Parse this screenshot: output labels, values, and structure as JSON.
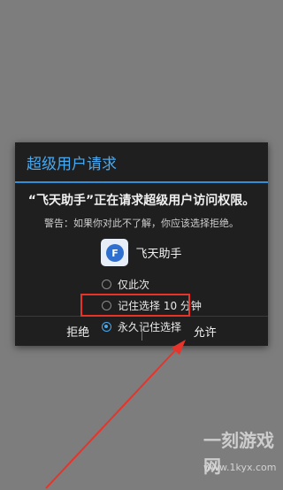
{
  "dialog": {
    "title": "超级用户请求",
    "message": "“飞天助手”正在请求超级用户访问权限。",
    "warning": "警告：如果你对此不了解，你应该选择拒绝。",
    "app_name": "飞天助手",
    "options": [
      {
        "label": "仅此次",
        "checked": false
      },
      {
        "label": "记住选择 10 分钟",
        "checked": false
      },
      {
        "label": "永久记住选择",
        "checked": true
      }
    ],
    "deny_label": "拒绝",
    "allow_label": "允许"
  },
  "watermark": {
    "logo_text": "一刻游戏网",
    "url": "www.1kyx.com"
  },
  "colors": {
    "accent": "#49a9ef",
    "highlight": "#e8332a"
  }
}
